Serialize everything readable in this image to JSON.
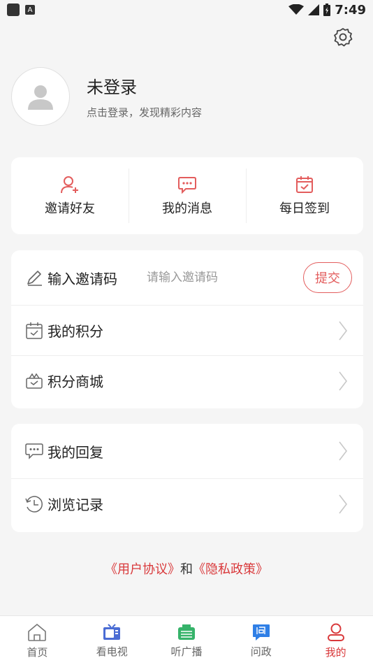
{
  "status_bar": {
    "time": "7:49"
  },
  "profile": {
    "title": "未登录",
    "subtitle": "点击登录，发现精彩内容"
  },
  "quick_actions": [
    {
      "label": "邀请好友",
      "icon": "add-user-icon"
    },
    {
      "label": "我的消息",
      "icon": "message-icon"
    },
    {
      "label": "每日签到",
      "icon": "calendar-check-icon"
    }
  ],
  "menu1": {
    "invite": {
      "label": "输入邀请码",
      "placeholder": "请输入邀请码",
      "submit": "提交"
    },
    "points": {
      "label": "我的积分"
    },
    "mall": {
      "label": "积分商城"
    }
  },
  "menu2": {
    "reply": {
      "label": "我的回复"
    },
    "history": {
      "label": "浏览记录"
    }
  },
  "agreement": {
    "user": "《用户协议》",
    "and": "和",
    "privacy": "《隐私政策》"
  },
  "tabs": [
    {
      "label": "首页"
    },
    {
      "label": "看电视"
    },
    {
      "label": "听广播"
    },
    {
      "label": "问政"
    },
    {
      "label": "我的"
    }
  ],
  "colors": {
    "accent": "#d9393b",
    "tv": "#4a6cd4",
    "radio": "#36b36a",
    "gov": "#2f7fe6"
  }
}
